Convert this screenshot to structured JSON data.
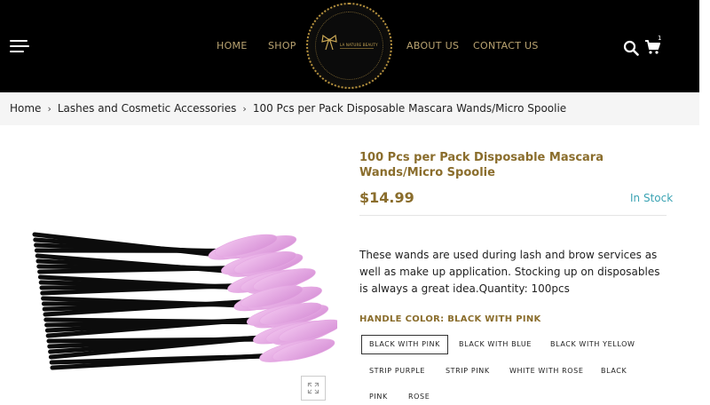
{
  "header": {
    "nav": {
      "home": "HOME",
      "shop": "SHOP",
      "about": "ABOUT US",
      "contact": "CONTACT US"
    },
    "logo_text": "LA NATURE BEAUTY",
    "cart_count": "1",
    "icons": [
      "hamburger-menu-icon",
      "search-icon",
      "cart-icon",
      "expand-icon"
    ]
  },
  "breadcrumb": {
    "items": [
      "Home",
      "Lashes and Cosmetic Accessories",
      "100 Pcs per Pack Disposable Mascara Wands/Micro Spoolie"
    ],
    "separator": "›"
  },
  "product": {
    "title": "100 Pcs per Pack Disposable Mascara Wands/Micro Spoolie",
    "price": "$14.99",
    "stock": "In Stock",
    "description": "These wands are used during lash and brow services as well as make up application.  Stocking up on disposables is always a great idea.Quantity: 100pcs",
    "option_label": "HANDLE COLOR: BLACK WITH PINK",
    "options": [
      "BLACK WITH PINK",
      "BLACK WITH BLUE",
      "BLACK WITH YELLOW",
      "STRIP PURPLE",
      "STRIP PINK",
      "WHITE WITH ROSE",
      "BLACK",
      "PINK",
      "ROSE"
    ],
    "selected_option": "BLACK WITH PINK"
  },
  "colors": {
    "header_bg": "#000000",
    "nav_text": "#b9a371",
    "accent_gold": "#8a6d2c",
    "stock_teal": "#3ba3b3",
    "breadcrumb_bg": "#f5f5f5"
  }
}
